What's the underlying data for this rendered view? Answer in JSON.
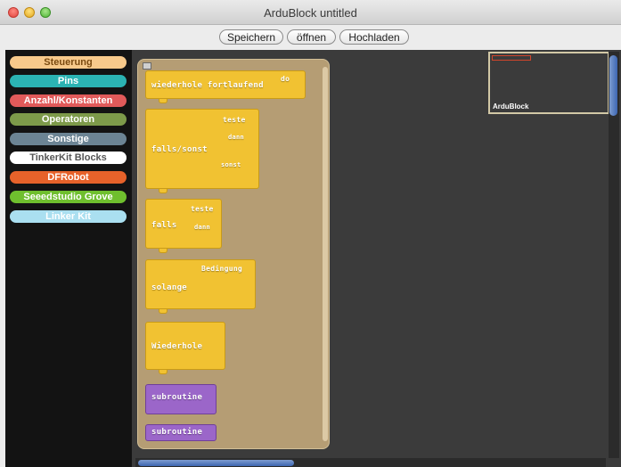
{
  "window": {
    "title": "ArduBlock untitled"
  },
  "toolbar": {
    "save_label": "Speichern",
    "open_label": "öffnen",
    "upload_label": "Hochladen"
  },
  "sidebar": {
    "items": [
      {
        "label": "Steuerung",
        "color": "#f7c98b",
        "text_color": "#7a4a10"
      },
      {
        "label": "Pins",
        "color": "#2bb3b3",
        "text_color": "#ffffff"
      },
      {
        "label": "Anzahl/Konstanten",
        "color": "#e15a5a",
        "text_color": "#ffffff"
      },
      {
        "label": "Operatoren",
        "color": "#7d9a4a",
        "text_color": "#ffffff"
      },
      {
        "label": "Sonstige",
        "color": "#6c8494",
        "text_color": "#ffffff"
      },
      {
        "label": "TinkerKit Blocks",
        "color": "#ffffff",
        "text_color": "#555555"
      },
      {
        "label": "DFRobot",
        "color": "#e7622a",
        "text_color": "#ffffff"
      },
      {
        "label": "Seeedstudio Grove",
        "color": "#6fbf2e",
        "text_color": "#ffffff"
      },
      {
        "label": "Linker Kit",
        "color": "#aadff0",
        "text_color": "#ffffff"
      }
    ]
  },
  "blocks": {
    "loop": {
      "label": "wiederhole fortlaufend",
      "socket": "do"
    },
    "ifelse": {
      "label": "falls/sonst",
      "sockets": [
        "teste",
        "dann",
        "sonst"
      ]
    },
    "if": {
      "label": "falls",
      "sockets": [
        "teste",
        "dann"
      ]
    },
    "while": {
      "label": "solange",
      "socket": "Bedingung"
    },
    "repeat": {
      "label": "Wiederhole"
    },
    "subroutine_def": {
      "label": "subroutine"
    },
    "subroutine_call": {
      "label": "subroutine"
    }
  },
  "minimap": {
    "label": "ArduBlock"
  },
  "colors": {
    "control_block": "#f1c232",
    "subroutine_block": "#9b66c9",
    "drawer": "#b59d74",
    "workspace": "#3b3b3b",
    "scroll_thumb": "#3d66b2"
  }
}
